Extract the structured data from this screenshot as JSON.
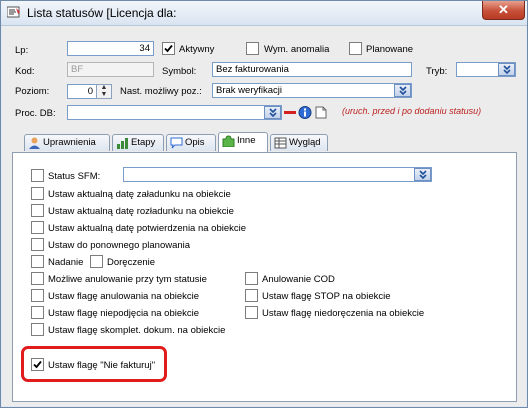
{
  "window": {
    "title": "Lista statusów  [Licencja dla:",
    "close_glyph": "✕"
  },
  "form": {
    "lp_label": "Lp:",
    "lp_value": "34",
    "aktywny_label": "Aktywny",
    "aktywny_checked": true,
    "wym_anomalia_label": "Wym. anomalia",
    "wym_anomalia_checked": false,
    "planowane_label": "Planowane",
    "planowane_checked": false,
    "kod_label": "Kod:",
    "kod_value": "BF",
    "symbol_label": "Symbol:",
    "symbol_value": "Bez fakturowania",
    "tryb_label": "Tryb:",
    "tryb_value": "",
    "poziom_label": "Poziom:",
    "poziom_value": "0",
    "spin_up": "▲",
    "spin_down": "▼",
    "nast_label": "Nast. możliwy poz.:",
    "nast_value": "Brak weryfikacji",
    "proc_label": "Proc. DB:",
    "proc_value": "",
    "proc_note": "(uruch. przed i po dodaniu statusu)"
  },
  "tabs": [
    {
      "label": "Uprawnienia",
      "icon": "users-icon",
      "active": false
    },
    {
      "label": "Etapy",
      "icon": "steps-icon",
      "active": false
    },
    {
      "label": "Opis",
      "icon": "speech-bubble-icon",
      "active": false
    },
    {
      "label": "Inne",
      "icon": "puzzle-icon",
      "active": true
    },
    {
      "label": "Wygląd",
      "icon": "table-icon",
      "active": false
    }
  ],
  "inne": {
    "status_sfm_label": "Status SFM:",
    "status_sfm_value": "",
    "left_options": [
      {
        "label": "Ustaw aktualną datę załadunku na obiekcie",
        "checked": false
      },
      {
        "label": "Ustaw aktualną datę rozładunku na obiekcie",
        "checked": false
      },
      {
        "label": "Ustaw aktualną datę potwierdzenia na obiekcie",
        "checked": false
      },
      {
        "label": "Ustaw do ponownego planowania",
        "checked": false
      }
    ],
    "nadanie_label": "Nadanie",
    "doreczenie_label": "Doręczenie",
    "left_options2": [
      {
        "label": "Możliwe anulowanie przy tym statusie",
        "checked": false
      },
      {
        "label": "Ustaw flagę anulowania na obiekcie",
        "checked": false
      },
      {
        "label": "Ustaw flagę niepodjęcia na obiekcie",
        "checked": false
      },
      {
        "label": "Ustaw flagę skomplet. dokum. na obiekcie",
        "checked": false
      }
    ],
    "right_options": [
      {
        "label": "Anulowanie COD",
        "checked": false
      },
      {
        "label": "Ustaw flagę STOP na obiekcie",
        "checked": false
      },
      {
        "label": "Ustaw flagę niedoręczenia na obiekcie",
        "checked": false
      }
    ],
    "nie_fakturuj_label": "Ustaw flagę \"Nie fakturuj\"",
    "nie_fakturuj_checked": true
  },
  "colors": {
    "highlight": "#e01c1c",
    "note": "#b22222",
    "field_border": "#7a9cc9"
  }
}
